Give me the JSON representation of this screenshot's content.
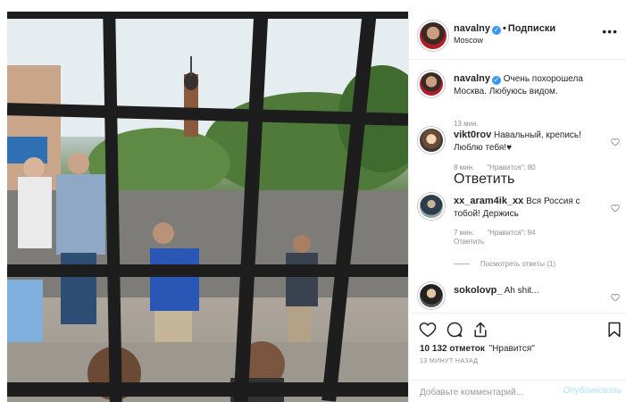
{
  "post": {
    "username": "navalny",
    "follow_label": "Подписки",
    "location": "Moscow",
    "more_label": "•••"
  },
  "caption": {
    "username": "navalny",
    "text": "Очень похорошела Москва. Любуюсь видом.",
    "time": "13 мин."
  },
  "comments": [
    {
      "username": "vikt0rov",
      "text": "Навальный, крепись! Люблю тебя!♥",
      "time": "8 мин.",
      "likes": "\"Нравится\": 80",
      "reply": "Ответить"
    },
    {
      "username": "xx_aram4ik_xx",
      "text": "Вся Россия с тобой! Держись",
      "time": "7 мин.",
      "likes": "\"Нравится\": 94",
      "reply": "Ответить"
    },
    {
      "username": "sokolovp_",
      "text": "Ah shit..."
    }
  ],
  "view_replies": "Посмотреть ответы (1)",
  "actions": {
    "likes_count": "10 132 отметок",
    "likes_suffix": "\"Нравится\"",
    "timestamp": "13 МИНУТ НАЗАД"
  },
  "comment_box": {
    "placeholder": "Добавьте комментарий...",
    "publish_label": "Опубликовать"
  },
  "colors": {
    "accent": "#3897f0",
    "publish_disabled": "#b2dffc",
    "muted": "#8e8e8e"
  },
  "icons": [
    "verified-badge-icon",
    "more-options-icon",
    "heart-icon",
    "comment-icon",
    "share-icon",
    "bookmark-icon"
  ]
}
